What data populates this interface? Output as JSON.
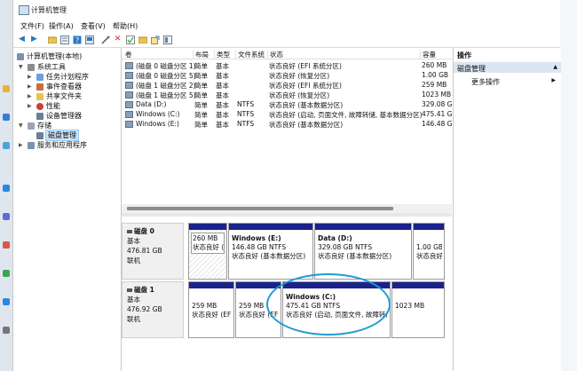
{
  "window": {
    "title": "计算机管理"
  },
  "menu": {
    "file": "文件(F)",
    "action": "操作(A)",
    "view": "查看(V)",
    "help": "帮助(H)"
  },
  "toolbar": {
    "back_glyph": "◀",
    "forward_glyph": "▶",
    "delete_glyph": "✕"
  },
  "tree": {
    "root": "计算机管理(本地)",
    "system_tools": "系统工具",
    "task_scheduler": "任务计划程序",
    "event_viewer": "事件查看器",
    "shared_folders": "共享文件夹",
    "performance": "性能",
    "device_manager": "设备管理器",
    "storage": "存储",
    "disk_management": "磁盘管理",
    "services_apps": "服务和应用程序"
  },
  "volumes": {
    "headers": {
      "volume": "卷",
      "layout": "布局",
      "type": "类型",
      "fs": "文件系统",
      "status": "状态",
      "capacity": "容量"
    },
    "rows": [
      {
        "volume": "(磁盘 0 磁盘分区 1)",
        "layout": "简单",
        "type": "基本",
        "fs": "",
        "status": "状态良好 (EFI 系统分区)",
        "capacity": "260 MB"
      },
      {
        "volume": "(磁盘 0 磁盘分区 5)",
        "layout": "简单",
        "type": "基本",
        "fs": "",
        "status": "状态良好 (恢复分区)",
        "capacity": "1.00 GB"
      },
      {
        "volume": "(磁盘 1 磁盘分区 2)",
        "layout": "简单",
        "type": "基本",
        "fs": "",
        "status": "状态良好 (EFI 系统分区)",
        "capacity": "259 MB"
      },
      {
        "volume": "(磁盘 1 磁盘分区 5)",
        "layout": "简单",
        "type": "基本",
        "fs": "",
        "status": "状态良好 (恢复分区)",
        "capacity": "1023 MB"
      },
      {
        "volume": "Data (D:)",
        "layout": "简单",
        "type": "基本",
        "fs": "NTFS",
        "status": "状态良好 (基本数据分区)",
        "capacity": "329.08 GB"
      },
      {
        "volume": "Windows (C:)",
        "layout": "简单",
        "type": "基本",
        "fs": "NTFS",
        "status": "状态良好 (启动, 页面文件, 故障转储, 基本数据分区)",
        "capacity": "475.41 GB"
      },
      {
        "volume": "Windows (E:)",
        "layout": "简单",
        "type": "基本",
        "fs": "NTFS",
        "status": "状态良好 (基本数据分区)",
        "capacity": "146.48 GB"
      }
    ]
  },
  "disks": [
    {
      "name": "磁盘 0",
      "kind": "基本",
      "size": "476.81 GB",
      "state": "联机",
      "partitions": [
        {
          "title": "",
          "size": "260 MB",
          "status": "状态良好 (EFI"
        },
        {
          "title": "Windows (E:)",
          "size": "146.48 GB NTFS",
          "status": "状态良好 (基本数据分区)"
        },
        {
          "title": "Data (D:)",
          "size": "329.08 GB NTFS",
          "status": "状态良好 (基本数据分区)"
        },
        {
          "title": "",
          "size": "1.00 GB",
          "status": "状态良好 (f"
        }
      ]
    },
    {
      "name": "磁盘 1",
      "kind": "基本",
      "size": "476.92 GB",
      "state": "联机",
      "partitions": [
        {
          "title": "",
          "size": "259 MB",
          "status": "状态良好 (EFI"
        },
        {
          "title": "",
          "size": "259 MB",
          "status": "状态良好 (EF"
        },
        {
          "title": "Windows (C:)",
          "size": "475.41 GB NTFS",
          "status": "状态良好 (启动, 页面文件, 故障转储"
        },
        {
          "title": "",
          "size": "1023 MB",
          "status": ""
        }
      ]
    }
  ],
  "actions": {
    "title": "操作",
    "selected": "磁盘管理",
    "more": "更多操作"
  },
  "colors": {
    "partition_bar": "#1a238a",
    "highlight_circle": "#1f9bd4"
  }
}
